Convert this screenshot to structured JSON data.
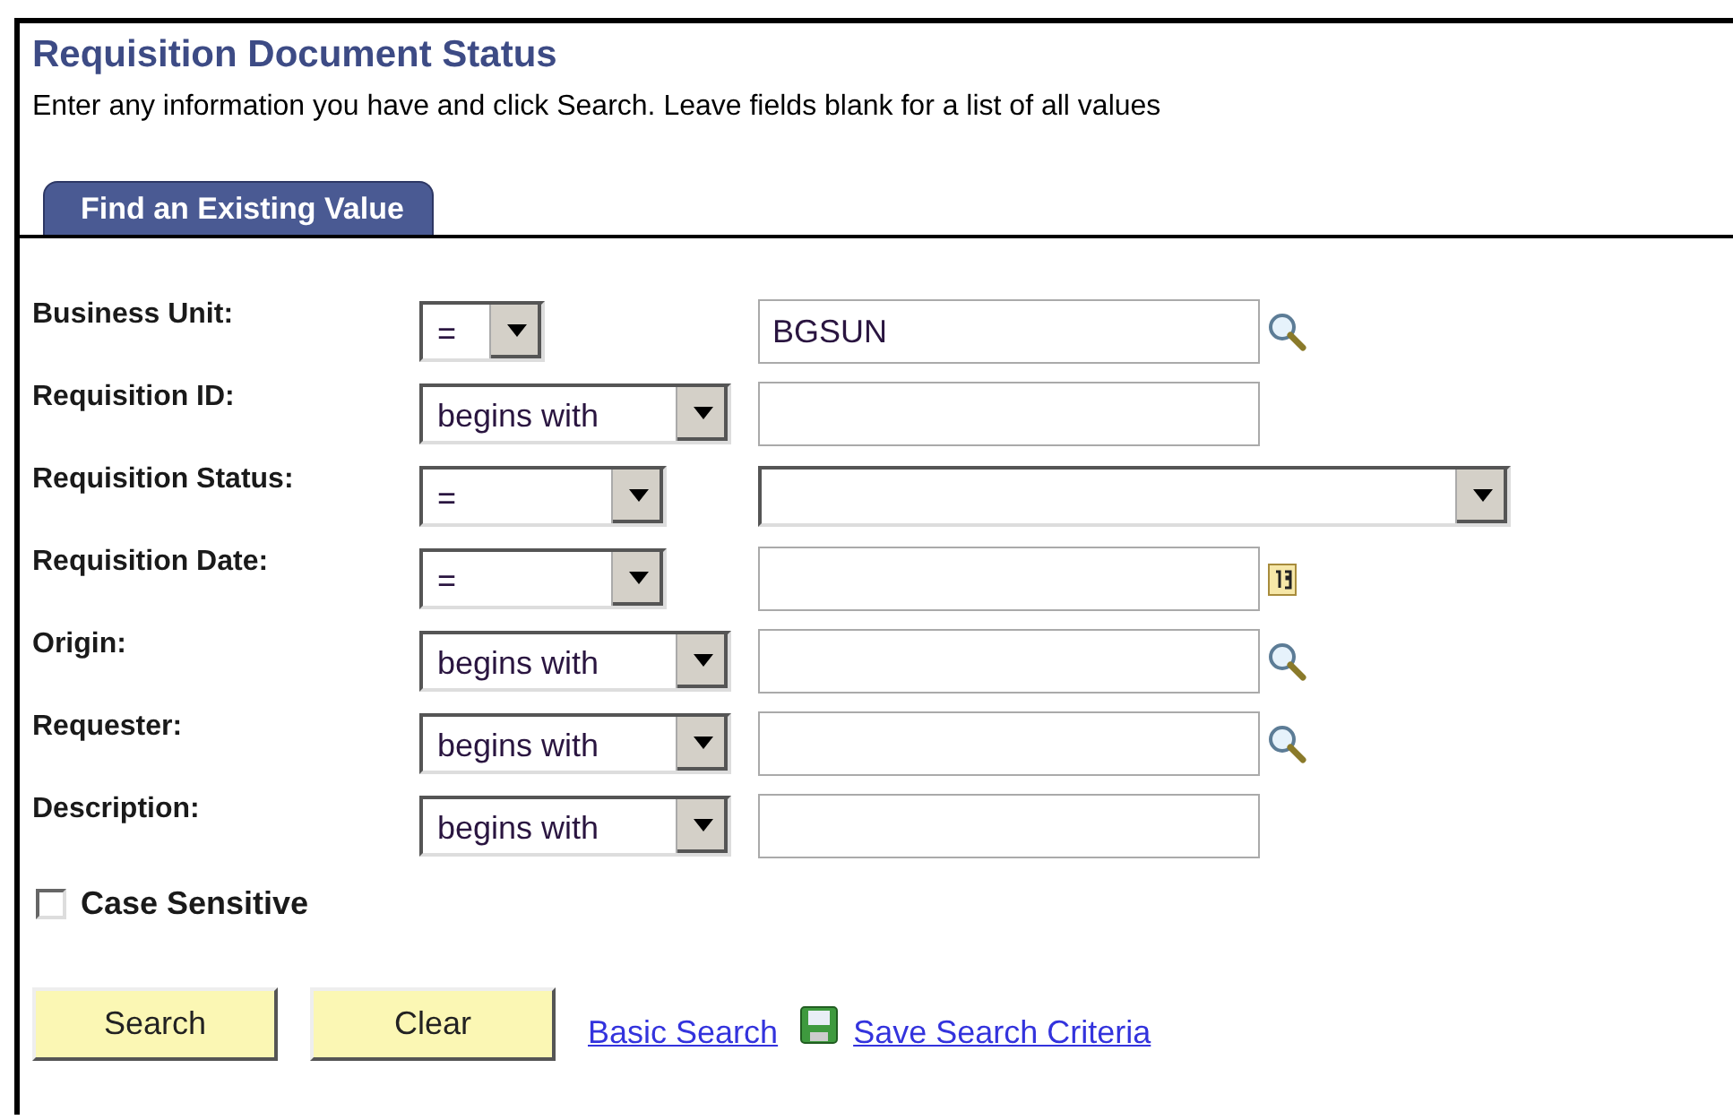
{
  "title": "Requisition Document Status",
  "instructions": "Enter any information you have and click Search. Leave fields blank for a list of all values",
  "tabs": [
    {
      "label": "Find an Existing Value",
      "selected": true
    }
  ],
  "fields": [
    {
      "label": "Business Unit:",
      "operator": "=",
      "kind": "lookup",
      "value": "BGSUN"
    },
    {
      "label": "Requisition ID:",
      "operator": "begins with",
      "kind": "plain"
    },
    {
      "label": "Requisition Status:",
      "operator": "=",
      "kind": "dropdown"
    },
    {
      "label": "Requisition Date:",
      "operator": "=",
      "kind": "date"
    },
    {
      "label": "Origin:",
      "operator": "begins with",
      "kind": "lookup"
    },
    {
      "label": "Requester:",
      "operator": "begins with",
      "kind": "lookup"
    },
    {
      "label": "Description:",
      "operator": "begins with",
      "kind": "plain"
    }
  ],
  "case_sensitive": {
    "label": "Case Sensitive",
    "checked": false
  },
  "buttons": [
    "Search",
    "Clear"
  ],
  "links": [
    {
      "label": "Basic Search",
      "kind": "plain"
    },
    {
      "label": "Save Search Criteria",
      "kind": "save"
    }
  ]
}
